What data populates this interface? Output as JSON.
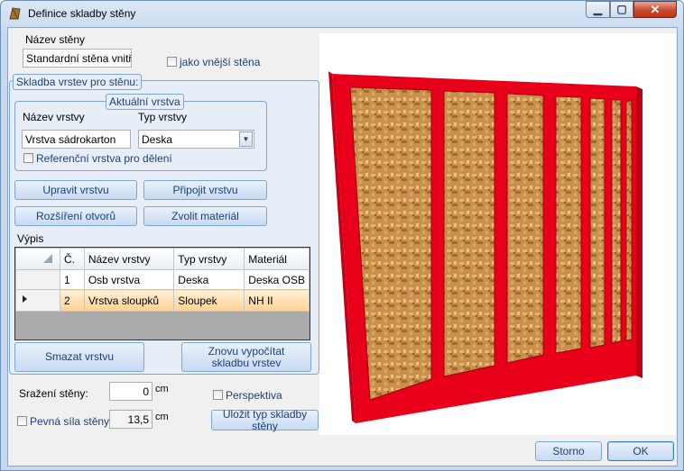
{
  "window": {
    "title": "Definice skladby stěny"
  },
  "wall_name": {
    "label": "Název stěny",
    "value": "Standardní stěna vnitřní",
    "exterior_checkbox": "jako vnější stěna"
  },
  "composition": {
    "group_title": "Skladba vrstev pro stěnu:",
    "current_layer": {
      "group_title": "Aktuální vrstva",
      "name_label": "Název vrstvy",
      "name_value": "Vrstva sádrokarton",
      "type_label": "Typ vrstvy",
      "type_value": "Deska",
      "reference_checkbox": "Referenční vrstva pro dělení"
    },
    "buttons": {
      "edit": "Upravit vrstvu",
      "attach": "Připojit vrstvu",
      "openings": "Rozšíření otvorů",
      "material": "Zvolit materiál",
      "delete": "Smazat vrstvu",
      "recalc": "Znovu vypočítat skladbu vrstev"
    },
    "list_label": "Výpis",
    "columns": [
      "Č.",
      "Název vrstvy",
      "Typ vrstvy",
      "Materiál"
    ],
    "rows": [
      {
        "no": "1",
        "name": "Osb vrstva",
        "type": "Deska",
        "material": "Deska OSB"
      },
      {
        "no": "2",
        "name": "Vrstva sloupků",
        "type": "Sloupek",
        "material": "NH II"
      }
    ]
  },
  "fields": {
    "rounding_label": "Sražení stěny:",
    "rounding_value": "0",
    "rounding_unit": "cm",
    "fixed_thickness_checkbox": "Pevná síla stěny",
    "fixed_thickness_value": "13,5",
    "fixed_thickness_unit": "cm",
    "perspective_checkbox": "Perspektiva",
    "save_type_button": "Uložit typ skladby stěny"
  },
  "footer": {
    "cancel": "Storno",
    "ok": "OK"
  },
  "colors": {
    "frame": "#e8001a",
    "osb": "#c8904a",
    "accent": "#1e3f7a"
  }
}
